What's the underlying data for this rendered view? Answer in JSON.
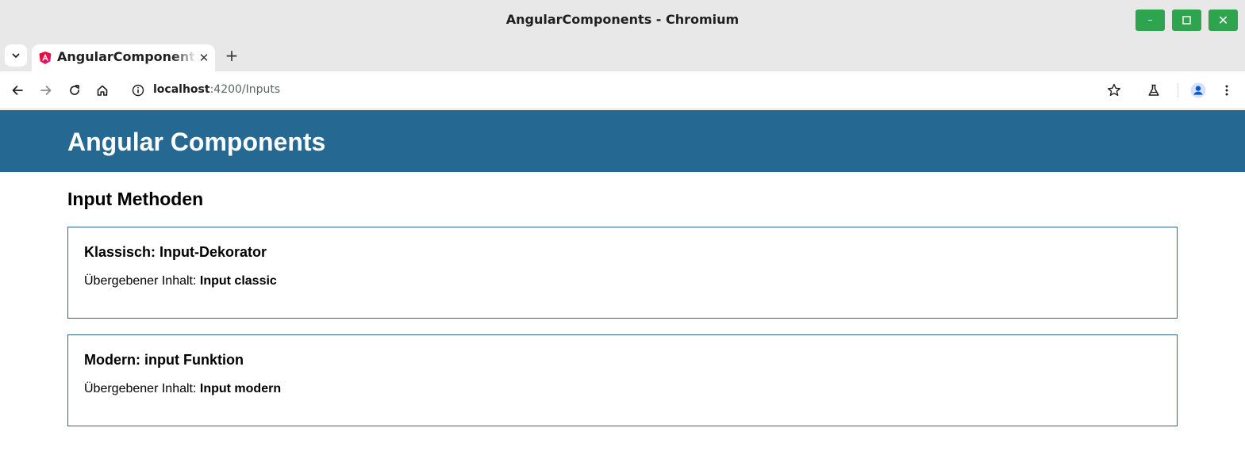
{
  "window": {
    "title": "AngularComponents - Chromium",
    "min_glyph": "–",
    "max_glyph": "☐",
    "close_glyph": "✕",
    "control_color": "#2ea44f"
  },
  "tabs": [
    {
      "title": "AngularComponents",
      "favicon": "angular-icon",
      "active": true
    }
  ],
  "tab_close_glyph": "✕",
  "new_tab_glyph": "+",
  "address_bar": {
    "host": "localhost",
    "path": ":4200/Inputs"
  },
  "icons": {
    "back": "back-arrow-icon",
    "forward": "forward-arrow-icon",
    "reload": "reload-icon",
    "home": "home-icon",
    "site_info": "info-icon",
    "bookmark": "star-icon",
    "labs": "flask-icon",
    "profile": "profile-avatar-icon",
    "menu": "kebab-menu-icon"
  },
  "app": {
    "title": "Angular Components",
    "header_color": "#256891"
  },
  "page": {
    "heading": "Input Methoden",
    "cards": [
      {
        "title": "Klassisch: Input-Dekorator",
        "label": "Übergebener Inhalt:",
        "value": "Input classic"
      },
      {
        "title": "Modern: input Funktion",
        "label": "Übergebener Inhalt:",
        "value": "Input modern"
      }
    ]
  }
}
